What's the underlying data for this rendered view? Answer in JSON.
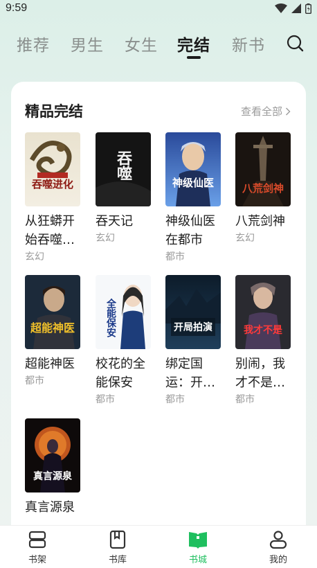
{
  "status": {
    "time": "9:59"
  },
  "tabs": [
    {
      "label": "推荐"
    },
    {
      "label": "男生"
    },
    {
      "label": "女生"
    },
    {
      "label": "完结",
      "active": true
    },
    {
      "label": "新书"
    }
  ],
  "section": {
    "title": "精品完结",
    "see_all": "查看全部"
  },
  "books": [
    {
      "title": "从狂蟒开始吞噬…",
      "genre": "玄幻",
      "cover_text": "吞噬进化"
    },
    {
      "title": "吞天记",
      "genre": "玄幻",
      "cover_text": "吞噬"
    },
    {
      "title": "神级仙医在都市",
      "genre": "都市",
      "cover_text": "神级仙医"
    },
    {
      "title": "八荒剑神",
      "genre": "玄幻",
      "cover_text": "八荒剑神"
    },
    {
      "title": "超能神医",
      "genre": "都市",
      "cover_text": "超能神医"
    },
    {
      "title": "校花的全能保安",
      "genre": "都市",
      "cover_text": "全能保安"
    },
    {
      "title": "绑定国运：开…",
      "genre": "都市",
      "cover_text": "开局拍演"
    },
    {
      "title": "别闹，我才不是…",
      "genre": "都市",
      "cover_text": "我才不是"
    },
    {
      "title": "真言源泉",
      "genre": "",
      "cover_text": "真言源泉"
    }
  ],
  "bottom_nav": [
    {
      "label": "书架",
      "icon": "bookshelf-icon"
    },
    {
      "label": "书库",
      "icon": "library-icon"
    },
    {
      "label": "书城",
      "icon": "bookstore-icon",
      "active": true
    },
    {
      "label": "我的",
      "icon": "profile-icon"
    }
  ],
  "colors": {
    "accent": "#1fbf5f"
  }
}
